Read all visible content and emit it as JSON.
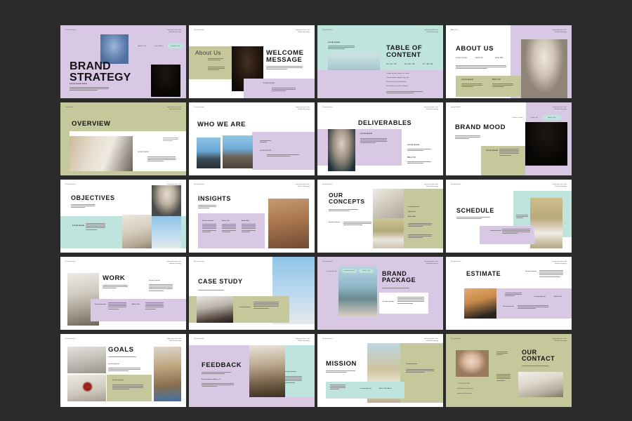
{
  "meta": {
    "background_color": "#2b2b2b",
    "palette": {
      "lilac": "#d9c8e4",
      "olive": "#c5c89a",
      "mint": "#bfe3dd",
      "white": "#ffffff",
      "ink": "#141414"
    }
  },
  "header_defaults": {
    "left": "Presentation",
    "right_line1": "www.yoursite.com",
    "right_line2": "Brand Strategy"
  },
  "slides": [
    {
      "id": "brand-strategy",
      "row": 1,
      "col": 1,
      "title": "BRAND\nSTRATEGY",
      "bg": "lilac",
      "header_left": "Presentation",
      "header_right_1": "www.yoursite.com",
      "header_right_2": "Brand Strategy",
      "subtitle": "Lorem Ipsum Dolor",
      "body": "Lorem ipsum dolor sit amet, consectetur adipiscing elit, sed do eiusmod tempor incididunt ut labore.",
      "nav": [
        "About Us",
        "Our Works",
        "Contact Us"
      ],
      "photos": [
        "blue-chair-portrait",
        "curly-hair-portrait"
      ]
    },
    {
      "id": "welcome-message",
      "row": 1,
      "col": 2,
      "title": "WELCOME\nMESSAGE",
      "bg": "white",
      "header_left": "Presentation",
      "header_right_1": "www.yoursite.com",
      "header_right_2": "Brand Strategy",
      "panel_label": "About Us",
      "body": "Lorem ipsum dolor sit amet, consectetur adipiscing elit, sed do eiusmod tempor incididunt.",
      "caption_label": "Lorem Ipsum",
      "photos": [
        "hat-woman-portrait"
      ]
    },
    {
      "id": "table-of-content",
      "row": 1,
      "col": 3,
      "title": "TABLE OF\nCONTENT",
      "bg": "mint",
      "header_left": "Presentation",
      "header_right_1": "www.yoursite.com",
      "header_right_2": "Brand Strategy",
      "kicker": "Lorem Ipsum",
      "columns": [
        "01 / 02 / 03",
        "04 / 05 / 06",
        "07 / 08 / 09"
      ],
      "items": [
        "Lorem ipsum dolor sit amet",
        "Consectetur adipiscing elit",
        "Sed do eiusmod tempor",
        "Incididunt ut labore dolore"
      ],
      "body": "Lorem ipsum dolor sit amet, consectetur adipiscing elit, sed do eiusmod tempor incididunt ut labore.",
      "photos": [
        "sea-standing-figure"
      ]
    },
    {
      "id": "about-us",
      "row": 1,
      "col": 4,
      "title": "ABOUT US",
      "bg": "lilac",
      "header_left": "About Us",
      "header_right_1": "www.yoursite.com",
      "header_right_2": "Brand Strategy",
      "tabs": [
        "Lorem Ipsum",
        "Dolor Sit",
        "Amet Elit"
      ],
      "body": "Lorem ipsum dolor sit amet, consectetur adipiscing elit, sed do eiusmod tempor incididunt ut labore et dolore magna.",
      "cards": [
        {
          "label": "Lorem Ipsum",
          "text": "Dolor sit amet consectetur adipiscing elit sed."
        },
        {
          "label": "Dolor Sit",
          "text": "Eiusmod tempor incididunt ut labore et dolore."
        }
      ],
      "photos": [
        "blonde-sitting"
      ]
    },
    {
      "id": "overview",
      "row": 2,
      "col": 1,
      "title": "OVERVIEW",
      "bg": "olive",
      "header_left": "Overview",
      "header_right_1": "www.yoursite.com",
      "header_right_2": "Brand Strategy",
      "side_note": "Lorem Ipsum\nDolor Sit",
      "body_label": "Lorem Ipsum",
      "body": "Dolor sit amet consectetur adipiscing elit sed do eiusmod tempor incididunt ut labore.",
      "photos": [
        "shoes-still-life"
      ]
    },
    {
      "id": "who-we-are",
      "row": 2,
      "col": 2,
      "title": "WHO WE ARE",
      "bg": "white",
      "header_left": "Presentation",
      "header_right_1": "www.yoursite.com",
      "header_right_2": "Brand Strategy",
      "panel_label": "Lorem Ipsum\nDolor Sit",
      "sub_label": "Lorem Ipsum",
      "body": "Dolor sit amet consectetur adipiscing elit sed do eiusmod tempor.",
      "photos": [
        "cliff-figure-one",
        "cliff-figure-two"
      ]
    },
    {
      "id": "deliverables",
      "row": 2,
      "col": 3,
      "title": "DELIVERABLES",
      "bg": "white",
      "header_left": "Presentation",
      "header_right_1": "www.yoursite.com",
      "header_right_2": "Brand Strategy",
      "panel_label": "Lorem Ipsum",
      "panel_body": "Dolor sit amet consectetur adipiscing elit sed do eiusmod tempor incididunt ut labore.",
      "side_items": [
        {
          "label": "Lorem Ipsum",
          "text": "Dolor sit amet consectetur adipiscing."
        },
        {
          "label": "Dolor Sit",
          "text": "Eiusmod tempor incididunt ut labore dolore."
        }
      ],
      "photos": [
        "dancer-blue-backdrop"
      ]
    },
    {
      "id": "brand-mood",
      "row": 2,
      "col": 4,
      "title": "BRAND MOOD",
      "bg": "white",
      "header_left": "Brand Mood",
      "header_right_1": "www.yoursite.com",
      "header_right_2": "Brand Strategy",
      "nav": [
        "Lorem Ipsum",
        "Dolor Sit",
        "Amet Elit"
      ],
      "subtitle": "Lorem ipsum dolor sit amet consectetur adipiscing elit.",
      "card_label": "Lorem Ipsum",
      "card_body": "Dolor sit amet consectetur adipiscing elit sed do eiusmod tempor incididunt ut labore.",
      "photos": [
        "curly-hair-fashion"
      ]
    },
    {
      "id": "objectives",
      "row": 3,
      "col": 1,
      "title": "OBJECTIVES",
      "bg": "white",
      "header_left": "Presentation",
      "header_right_1": "www.yoursite.com",
      "header_right_2": "Brand Strategy",
      "subtitle": "Lorem ipsum dolor sit amet consectetur adipiscing elit sed.",
      "panel_label": "Lorem Ipsum",
      "panel_body": "Dolor sit amet consectetur adipiscing elit sed do eiusmod tempor incididunt.",
      "photos": [
        "ruffle-portrait",
        "beige-pose",
        "blue-sky-pose"
      ]
    },
    {
      "id": "insights",
      "row": 3,
      "col": 2,
      "title": "INSIGHTS",
      "bg": "white",
      "header_left": "Presentation",
      "header_right_1": "www.yoursite.com",
      "header_right_2": "Brand Strategy",
      "subtitle": "Lorem ipsum dolor sit amet consectetur adipiscing.",
      "columns": [
        {
          "label": "Lorem Ipsum",
          "text": "Dolor sit amet consectetur adipiscing elit sed do eiusmod tempor."
        },
        {
          "label": "Dolor Sit",
          "text": "Eiusmod tempor incididunt ut labore et dolore magna aliqua."
        },
        {
          "label": "Amet Elit",
          "text": "Ut enim ad minim veniam quis nostrud exercitation ullamco."
        }
      ],
      "photos": [
        "tan-dress-walking"
      ]
    },
    {
      "id": "our-concepts",
      "row": 3,
      "col": 3,
      "title": "OUR\nCONCEPTS",
      "bg": "white",
      "header_left": "Presentation",
      "header_right_1": "www.yoursite.com",
      "header_right_2": "Brand Strategy",
      "subtitle": "Lorem ipsum dolor sit amet consectetur adipiscing elit.",
      "note_label": "Lorem Ipsum",
      "note_body": "Dolor sit amet consectetur adipiscing elit sed do eiusmod tempor incididunt ut labore.",
      "side_items": [
        "Lorem Ipsum",
        "Dolor Sit",
        "Amet Elit"
      ],
      "side_body": "Consectetur adipiscing elit sed do eiusmod tempor incididunt ut labore et dolore.",
      "photos": [
        "fabric-detail",
        "field-hat-woman"
      ]
    },
    {
      "id": "schedule",
      "row": 3,
      "col": 4,
      "title": "SCHEDULE",
      "bg": "white",
      "header_left": "Presentation",
      "header_right_1": "www.yoursite.com",
      "header_right_2": "Brand Strategy",
      "subtitle": "Lorem ipsum dolor sit amet consectetur adipiscing elit sed do eiusmod tempor.",
      "mint_label": "Lorem Ipsum\nDolor Sit Amet",
      "card_label": "Lorem Ipsum",
      "card_body": "Dolor sit amet consectetur adipiscing elit sed do eiusmod tempor incididunt ut labore.",
      "photos": [
        "wheat-field-woman"
      ]
    },
    {
      "id": "work",
      "row": 4,
      "col": 1,
      "title": "WORK",
      "bg": "white",
      "header_left": "Presentation",
      "header_right_1": "www.yoursite.com",
      "header_right_2": "Brand Strategy",
      "subtitle": "Lorem ipsum dolor sit amet consectetur adipiscing elit sed do eiusmod.",
      "side_label": "Lorem Ipsum",
      "side_body": "Dolor sit amet consectetur adipiscing elit sed do eiusmod tempor incididunt ut labore dolore.",
      "cards": [
        {
          "label": "Lorem Ipsum",
          "text": "Dolor sit amet consectetur adipiscing elit sed do tempor."
        },
        {
          "label": "Dolor Sit",
          "text": "Eiusmod tempor incididunt ut labore et dolore magna aliqua."
        }
      ],
      "photos": [
        "long-dress-walking"
      ]
    },
    {
      "id": "case-study",
      "row": 4,
      "col": 2,
      "title": "CASE STUDY",
      "bg": "white",
      "header_left": "Presentation",
      "header_right_1": "www.yoursite.com",
      "header_right_2": "Brand Strategy",
      "subtitle": "Lorem ipsum dolor sit amet consectetur adipiscing elit.",
      "card_label": "Lorem Ipsum",
      "card_body": "Dolor sit amet consectetur adipiscing elit sed do eiusmod tempor incididunt ut labore.",
      "photos": [
        "blue-sky-reach",
        "brunette-profile"
      ]
    },
    {
      "id": "brand-package",
      "row": 4,
      "col": 3,
      "title": "BRAND\nPACKAGE",
      "bg": "lilac",
      "header_left": "Presentation",
      "header_right_1": "www.yoursite.com",
      "header_right_2": "Brand Strategy",
      "side_label": "Lorem Ipsum",
      "chips": [
        "Lorem Ipsum",
        "Dolor Sit"
      ],
      "subtitle": "Lorem ipsum dolor sit amet consectetur adipiscing elit.",
      "card_label": "Lorem Ipsum",
      "card_body": "Dolor sit amet consectetur adipiscing elit sed do eiusmod tempor incididunt ut labore et dolore magna.",
      "photos": [
        "sea-woman-portrait"
      ]
    },
    {
      "id": "estimate",
      "row": 4,
      "col": 4,
      "title": "ESTIMATE",
      "bg": "white",
      "header_left": "Presentation",
      "header_right_1": "www.yoursite.com",
      "header_right_2": "Brand Strategy",
      "list_label": "Lorem Ipsum",
      "list_items": [
        "Lorem ipsum dolor sit",
        "Consectetur adipiscing elit",
        "Sed do eiusmod tempor",
        "Incididunt ut labore et",
        "Dolore magna aliqua enim"
      ],
      "panel_body": "Lorem ipsum dolor sit amet consectetur adipiscing elit.",
      "panel_cols": [
        "Lorem Ipsum",
        "Dolor Sit"
      ],
      "card_label": "Lorem Ipsum",
      "card_body": "Dolor sit amet consectetur adipiscing elit sed do eiusmod tempor incididunt.",
      "photos": [
        "tan-jacket-pose"
      ]
    },
    {
      "id": "goals",
      "row": 5,
      "col": 1,
      "title": "GOALS",
      "bg": "white",
      "header_left": "Presentation",
      "header_right_1": "www.yoursite.com",
      "header_right_2": "Brand Strategy",
      "subtitle": "Lorem ipsum dolor sit amet consectetur adipiscing elit sed.",
      "section_label": "Lorem Ipsum",
      "body": "Dolor sit amet consectetur adipiscing elit sed do eiusmod tempor incididunt ut labore et dolore magna.",
      "card_label": "Lorem Ipsum",
      "card_body": "Dolor sit amet consectetur adipiscing elit sed do eiusmod tempor incididunt ut labore.",
      "photos": [
        "gray-wall-pose",
        "red-flower-pose",
        "camera-girl"
      ]
    },
    {
      "id": "feedback",
      "row": 5,
      "col": 2,
      "title": "FEEDBACK",
      "bg": "lilac",
      "header_left": "Presentation",
      "header_right_1": "www.yoursite.com",
      "header_right_2": "Brand Strategy",
      "subtitle": "Lorem ipsum dolor sit amet consectetur adipiscing elit sed.",
      "quote_label": "Lorem ipsum dolor sit",
      "quote_body": "Consectetur adipiscing elit sed do eiusmod tempor incididunt ut labore.",
      "side_label": "Lorem Ipsum",
      "side_body": "Dolor sit amet consectetur adipiscing elit sed do eiusmod tempor.",
      "photos": [
        "walking-brown-suit"
      ]
    },
    {
      "id": "mission",
      "row": 5,
      "col": 3,
      "title": "MISSION",
      "bg": "white",
      "header_left": "Presentation",
      "header_right_1": "www.yoursite.com",
      "header_right_2": "Brand Strategy",
      "subtitle": "Lorem ipsum dolor sit amet consectetur adipiscing elit.",
      "side_label": "Lorem Ipsum",
      "side_body": "Dolor sit amet consectetur adipiscing elit sed do eiusmod tempor incididunt ut labore et dolore.",
      "mint_body": "Lorem ipsum dolor sit amet consectetur adipiscing.",
      "mint_cols": [
        "Lorem Ipsum",
        "Dolor Sit Amet"
      ],
      "photos": [
        "field-white-dress"
      ]
    },
    {
      "id": "our-contact",
      "row": 5,
      "col": 4,
      "title": "OUR\nCONTACT",
      "bg": "olive",
      "header_left": "Presentation",
      "header_right_1": "www.yoursite.com",
      "header_right_2": "Brand Strategy",
      "subtitle": "Lorem ipsum dolor sit amet consectetur adipiscing elit.",
      "note_label": "Lorem Ipsum\nDolor Sit",
      "note_body": "Consectetur adipiscing elit sed do eiusmod tempor incididunt ut labore.",
      "contacts": [
        "+1 234 567 890",
        "hello@yoursite.com",
        "www.yoursite.com"
      ],
      "photos": [
        "face-portrait",
        "hands-detail"
      ]
    }
  ]
}
